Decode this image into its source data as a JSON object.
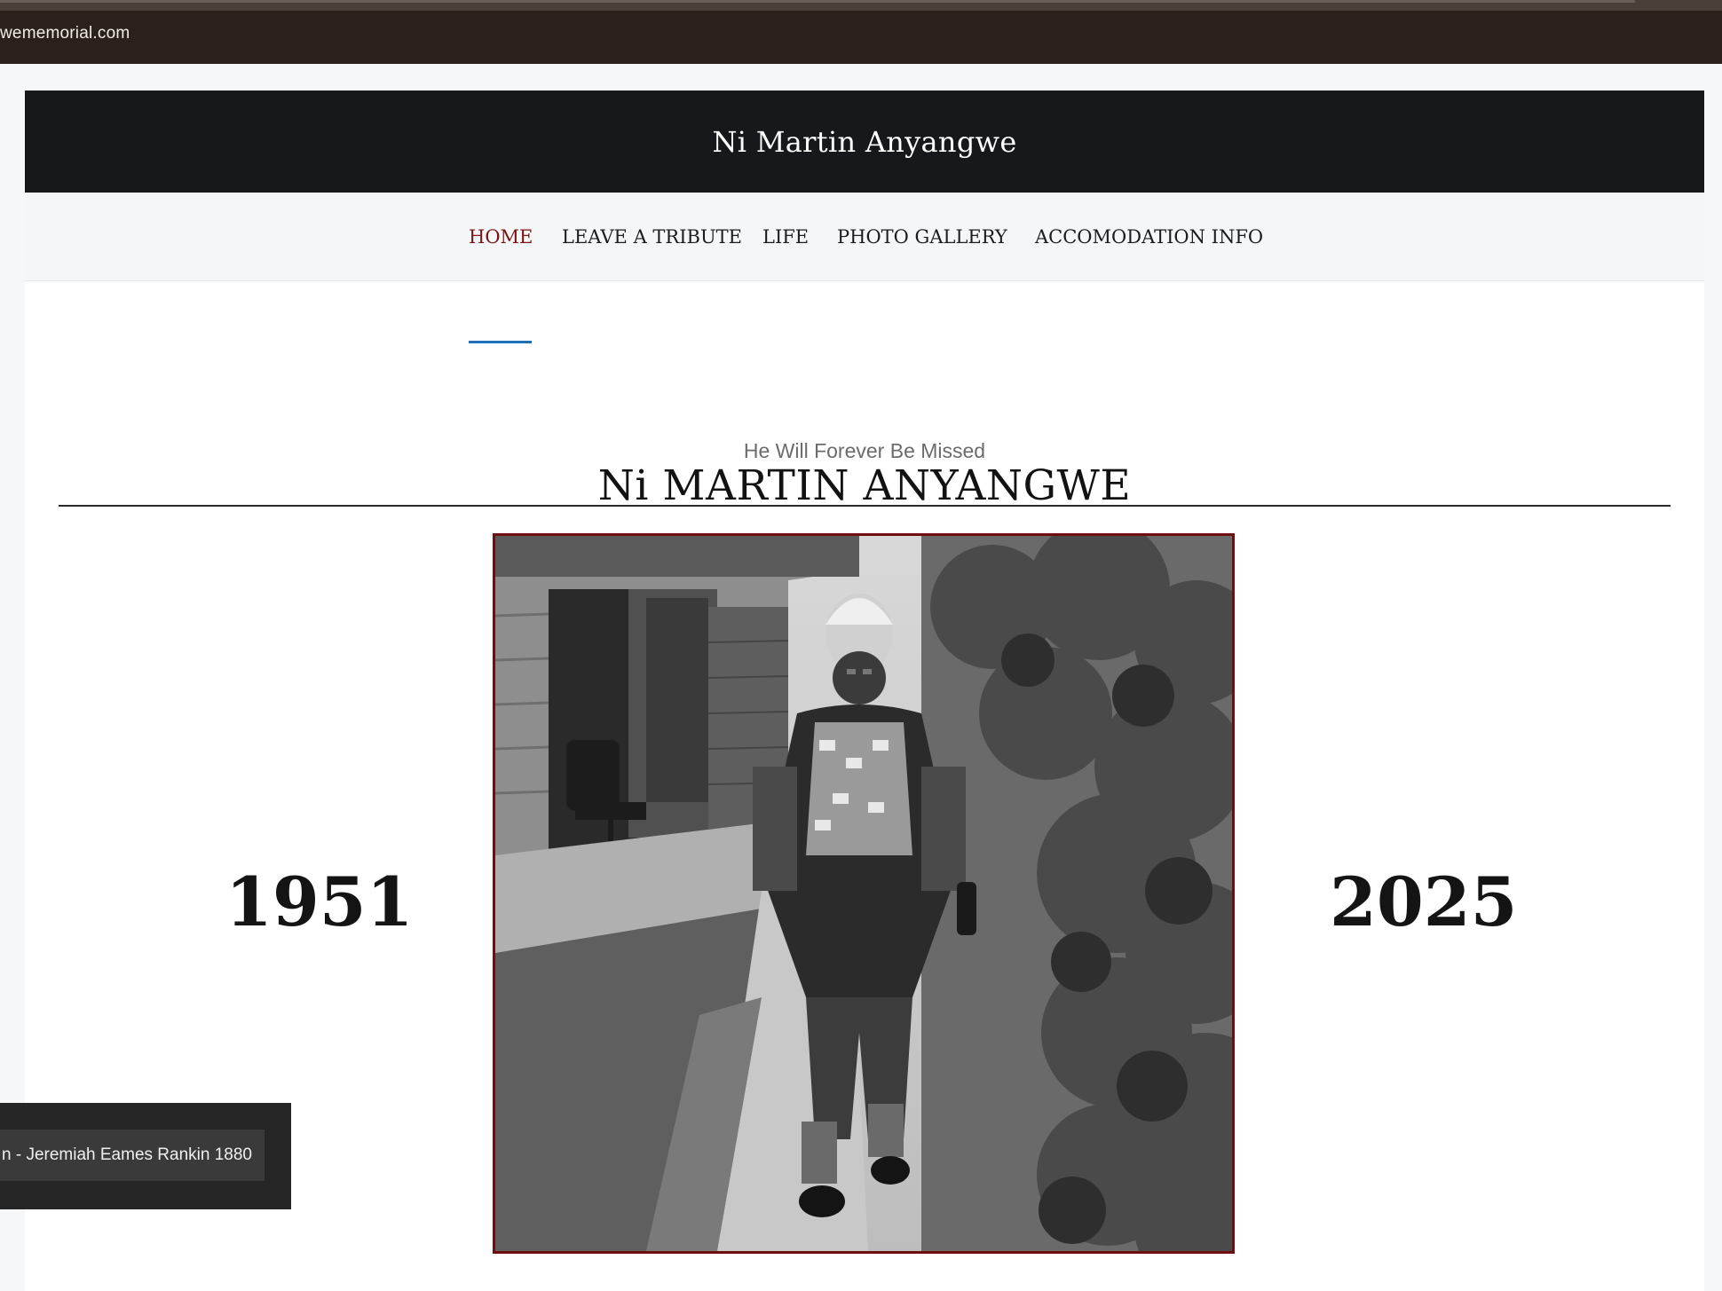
{
  "browser": {
    "url": "wememorial.com"
  },
  "site": {
    "title": "Ni Martin Anyangwe"
  },
  "nav": {
    "items": [
      {
        "label": "HOME",
        "active": true
      },
      {
        "label": "LEAVE A TRIBUTE",
        "active": false
      },
      {
        "label": "LIFE",
        "active": false
      },
      {
        "label": "PHOTO GALLERY",
        "active": false
      },
      {
        "label": "ACCOMODATION INFO",
        "active": false
      }
    ]
  },
  "memorial": {
    "subtitle": "He Will Forever Be Missed",
    "name": "Ni MARTIN ANYANGWE",
    "birth_year": "1951",
    "death_year": "2025"
  },
  "tooltip": {
    "text": "n - Jeremiah Eames Rankin 1880"
  },
  "colors": {
    "header_bg": "#17181b",
    "active_nav": "#7a1414",
    "nav_underline": "#1f6fb8",
    "photo_border": "#6e0f0f"
  }
}
